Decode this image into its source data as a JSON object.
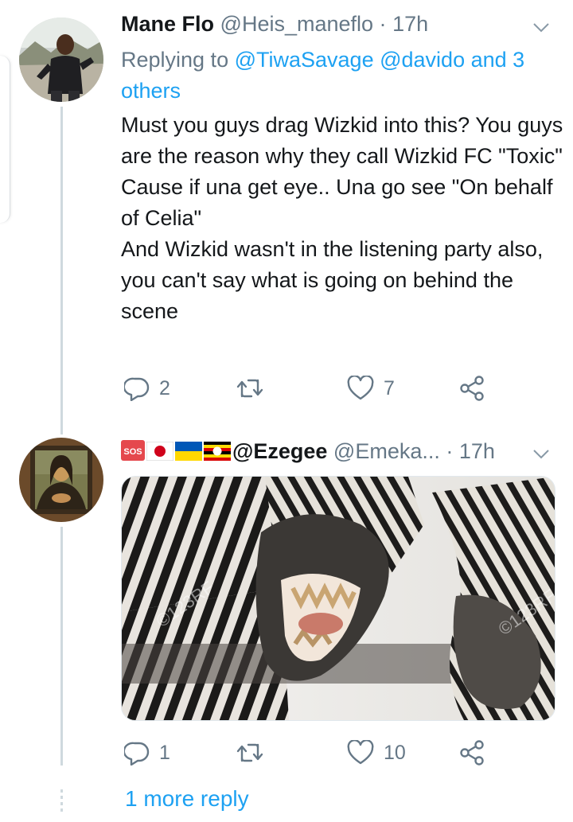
{
  "tweets": [
    {
      "author_name": "Mane Flo",
      "author_handle": "@Heis_maneflo",
      "separator": "·",
      "time": "17h",
      "replying_prefix": "Replying to ",
      "replying_users": [
        "@TiwaSavage",
        "@davido"
      ],
      "replying_and": " and",
      "replying_others": "3 others",
      "body_lines": [
        "Must you guys drag Wizkid into this? You guys are the reason why they call Wizkid FC \"Toxic\"",
        "Cause if una get eye.. Una go see \"On behalf of Celia\"",
        "And Wizkid wasn't in the listening party also, you can't say what is going on behind the scene"
      ],
      "replies": "2",
      "retweets": "",
      "likes": "7",
      "avatar_icon": "avatar-man-photo"
    },
    {
      "author_name": "@Ezegee",
      "author_emoji_prefix": [
        "sos-badge",
        "japan-flag",
        "ukraine-flag",
        "uganda-flag"
      ],
      "author_handle": "@Emeka...",
      "separator": "·",
      "time": "17h",
      "media_description": "zebra-photo",
      "media_watermark": "©123RF",
      "replies": "1",
      "retweets": "",
      "likes": "10",
      "avatar_icon": "avatar-mona-lisa"
    }
  ],
  "more_reply": "1 more reply",
  "sos_text": "SOS",
  "colors": {
    "accent": "#1da1f2",
    "secondary_text": "#657786",
    "thread_line": "#cfd9de"
  }
}
